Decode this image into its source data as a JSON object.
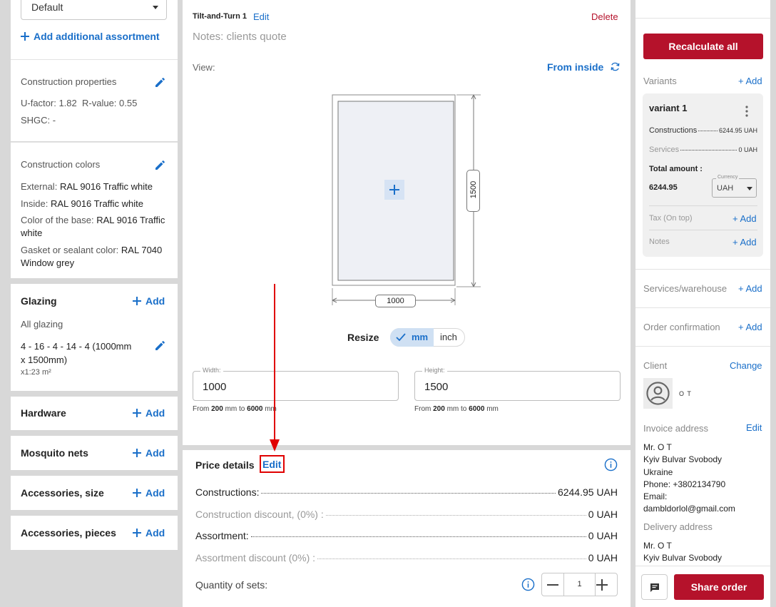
{
  "left": {
    "select_value": "Default",
    "add_assortment": "Add additional assortment",
    "construction_properties": {
      "title": "Construction properties",
      "ufactor": "U-factor: 1.82",
      "rvalue": "R-value: 0.55",
      "shgc": "SHGC: -"
    },
    "construction_colors": {
      "title": "Construction colors",
      "external_label": "External:",
      "external_value": "RAL 9016 Traffic white",
      "inside_label": "Inside:",
      "inside_value": "RAL 9016 Traffic white",
      "base_label": "Color of the base:",
      "base_value": "RAL 9016 Traffic white",
      "gasket_label": "Gasket or sealant color:",
      "gasket_value": "RAL 7040 Window grey"
    },
    "glazing": {
      "title": "Glazing",
      "add": "Add",
      "subtitle": "All glazing",
      "spec": "4 - 16 - 4 - 14 - 4 (1000mm x 1500mm)",
      "qty": "x1:23 m²"
    },
    "hardware": {
      "title": "Hardware",
      "add": "Add"
    },
    "mosquito": {
      "title": "Mosquito nets",
      "add": "Add"
    },
    "acc_size": {
      "title": "Accessories, size",
      "add": "Add"
    },
    "acc_pieces": {
      "title": "Accessories, pieces",
      "add": "Add"
    }
  },
  "center": {
    "product_name": "Tilt-and-Turn 1",
    "edit": "Edit",
    "delete": "Delete",
    "notes": "Notes: clients quote",
    "view_label": "View:",
    "view_mode": "From inside",
    "dim_height": "1500",
    "dim_width": "1000",
    "resize_label": "Resize",
    "unit_mm": "mm",
    "unit_inch": "inch",
    "width_field": {
      "label": "Width:",
      "value": "1000"
    },
    "height_field": {
      "label": "Height:",
      "value": "1500"
    },
    "range_from": "From",
    "range_min": "200",
    "range_mid": "mm to",
    "range_max": "6000",
    "range_unit": "mm"
  },
  "price": {
    "title": "Price details",
    "edit": "Edit",
    "rows": [
      {
        "label": "Constructions:",
        "value": "6244.95 UAH"
      },
      {
        "label": "Construction discount, (0%) :",
        "value": "0 UAH"
      },
      {
        "label": "Assortment:",
        "value": "0 UAH"
      },
      {
        "label": "Assortment discount (0%) :",
        "value": "0 UAH"
      }
    ],
    "quantity_label": "Quantity of sets:",
    "quantity_value": "1"
  },
  "right": {
    "recalculate": "Recalculate all",
    "variants_label": "Variants",
    "add": "Add",
    "variant": {
      "name": "variant 1",
      "constructions_label": "Constructions",
      "constructions_value": "6244.95 UAH",
      "services_label": "Services",
      "services_value": "0 UAH",
      "total_label": "Total amount :",
      "total_value": "6244.95",
      "currency_label": "Currency",
      "currency_value": "UAH",
      "tax_label": "Tax (On top)",
      "notes_label": "Notes"
    },
    "services_warehouse": "Services/warehouse",
    "order_confirmation": "Order confirmation",
    "client_label": "Client",
    "change": "Change",
    "client_name": "O T",
    "invoice_label": "Invoice address",
    "invoice_lines": [
      "Mr. O T",
      "Kyiv Bulvar Svobody",
      "Ukraine",
      "Phone: +3802134790",
      "Email:",
      "dambldorlol@gmail.com"
    ],
    "delivery_label": "Delivery address",
    "delivery_lines": [
      "Mr. O T",
      "Kyiv Bulvar Svobody"
    ],
    "share": "Share order"
  },
  "colors": {
    "accent": "#1a6fc9",
    "danger": "#b5122b",
    "highlight": "#e00000"
  }
}
